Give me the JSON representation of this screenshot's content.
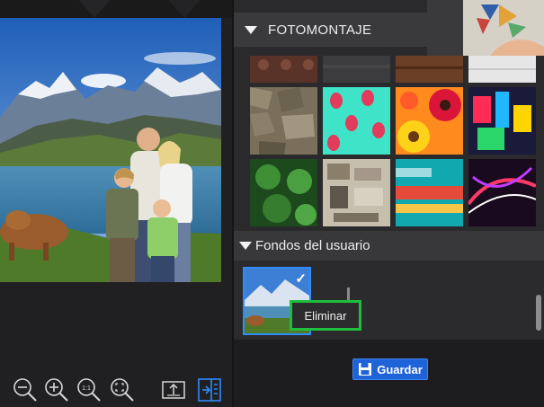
{
  "panel": {
    "fotomontaje_label": "FOTOMONTAJE",
    "user_backgrounds_label": "Fondos del usuario",
    "tooltip_label": "Eliminar",
    "save_label": "Guardar",
    "check_mark": "✓"
  },
  "toolbar": {
    "zoom_actual_label": "1:1"
  },
  "icons": [
    "zoom-out-icon",
    "zoom-in-icon",
    "zoom-actual-icon",
    "zoom-fit-icon",
    "export-icon",
    "panel-toggle-icon",
    "save-icon"
  ],
  "colors": {
    "accent": "#1f63d8",
    "selection": "#2f8cff",
    "highlight": "#1fbe3c"
  }
}
